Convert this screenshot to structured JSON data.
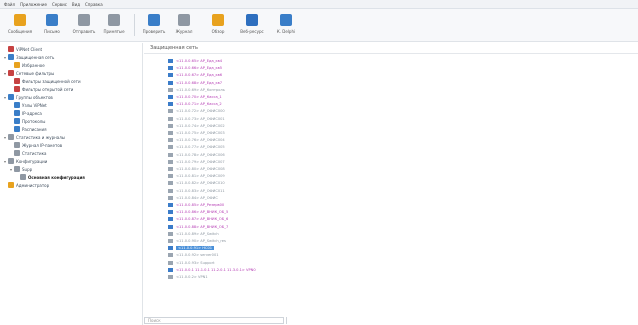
{
  "menu": {
    "items": [
      "Файл",
      "Приложение",
      "Сервис",
      "Вид",
      "Справка"
    ]
  },
  "toolbar": {
    "left_buttons": [
      {
        "label": "Сообщения",
        "icon": "messages-icon",
        "color": "#e8a21e"
      },
      {
        "label": "Письмо",
        "icon": "mail-icon",
        "color": "#3a7ec8"
      },
      {
        "label": "Отправить",
        "icon": "send-file-icon",
        "color": "#8f98a3"
      },
      {
        "label": "Принятые",
        "icon": "received-files-icon",
        "color": "#8f98a3"
      }
    ],
    "right_buttons": [
      {
        "label": "Проверить",
        "icon": "check-icon",
        "color": "#3a7ec8"
      },
      {
        "label": "Журнал",
        "icon": "journal-icon",
        "color": "#8f98a3"
      },
      {
        "label": "Обзор",
        "icon": "overview-icon",
        "color": "#e8a21e"
      },
      {
        "label": "Веб-ресурс",
        "icon": "web-resource-icon",
        "color": "#2e6fbf"
      },
      {
        "label": "К. Delphi",
        "icon": "connect-icon",
        "color": "#3a7ec8"
      }
    ]
  },
  "tree": {
    "items": [
      {
        "label": "ViPNet Client",
        "level": 0,
        "expander": "",
        "icon": "vipnet-client-icon",
        "color": "#c64242",
        "bold": false
      },
      {
        "label": "Защищенная сеть",
        "level": 0,
        "expander": "▾",
        "icon": "protected-network-icon",
        "color": "#3a7ec8",
        "bold": false
      },
      {
        "label": "Избранное",
        "level": 1,
        "expander": "",
        "icon": "favorites-icon",
        "color": "#e8a21e",
        "bold": false
      },
      {
        "label": "Сетевые фильтры",
        "level": 0,
        "expander": "▾",
        "icon": "network-filters-icon",
        "color": "#c64242",
        "bold": false
      },
      {
        "label": "Фильтры защищенной сети",
        "level": 1,
        "expander": "",
        "icon": "filter-icon",
        "color": "#c64242",
        "bold": false
      },
      {
        "label": "Фильтры открытой сети",
        "level": 1,
        "expander": "",
        "icon": "filter-icon",
        "color": "#c64242",
        "bold": false
      },
      {
        "label": "Группы объектов",
        "level": 0,
        "expander": "▾",
        "icon": "object-groups-icon",
        "color": "#3a7ec8",
        "bold": false
      },
      {
        "label": "Узлы ViPNet",
        "level": 1,
        "expander": "",
        "icon": "nodes-icon",
        "color": "#3a7ec8",
        "bold": false
      },
      {
        "label": "IP-адреса",
        "level": 1,
        "expander": "",
        "icon": "ip-address-icon",
        "color": "#3a7ec8",
        "bold": false
      },
      {
        "label": "Протоколы",
        "level": 1,
        "expander": "",
        "icon": "protocols-icon",
        "color": "#3a7ec8",
        "bold": false
      },
      {
        "label": "Расписания",
        "level": 1,
        "expander": "",
        "icon": "schedule-icon",
        "color": "#3a7ec8",
        "bold": false
      },
      {
        "label": "Статистика и журналы",
        "level": 0,
        "expander": "▾",
        "icon": "statistics-icon",
        "color": "#8f98a3",
        "bold": false
      },
      {
        "label": "Журнал IP-пакетов",
        "level": 1,
        "expander": "",
        "icon": "packet-log-icon",
        "color": "#8f98a3",
        "bold": false
      },
      {
        "label": "Статистика",
        "level": 1,
        "expander": "",
        "icon": "stats-icon",
        "color": "#8f98a3",
        "bold": false
      },
      {
        "label": "Конфигурации",
        "level": 0,
        "expander": "▾",
        "icon": "configurations-icon",
        "color": "#8f98a3",
        "bold": false
      },
      {
        "label": "Supp",
        "level": 1,
        "expander": "▾",
        "icon": "config-item-icon",
        "color": "#8f98a3",
        "bold": false
      },
      {
        "label": "Основная конфигурация",
        "level": 2,
        "expander": "",
        "icon": "main-config-icon",
        "color": "#8f98a3",
        "bold": true
      },
      {
        "label": "Администратор",
        "level": 0,
        "expander": "",
        "icon": "administrator-icon",
        "color": "#e8a21e",
        "bold": false
      }
    ]
  },
  "main": {
    "title": "Защищенная сеть",
    "filter_placeholder": "Поиск",
    "rows": [
      {
        "text": "<11.0.0.65> AP_Еда_кв4",
        "kind": "vip"
      },
      {
        "text": "<11.0.0.66> AP_Еда_кв5",
        "kind": "vip"
      },
      {
        "text": "<11.0.0.67> AP_Еда_кв6",
        "kind": "vip"
      },
      {
        "text": "<11.0.0.68> AP_Еда_кв7",
        "kind": "vip"
      },
      {
        "text": "<11.0.0.69> AP_Контроль",
        "kind": "gray"
      },
      {
        "text": "<11.0.0.70> AP_Касса_1",
        "kind": "vip"
      },
      {
        "text": "<11.0.0.71> AP_Касса_2",
        "kind": "vip"
      },
      {
        "text": "<11.0.0.72> AP_ОФИС000",
        "kind": "gray"
      },
      {
        "text": "<11.0.0.73> AP_ОФИС001",
        "kind": "gray"
      },
      {
        "text": "<11.0.0.74> AP_ОФИС002",
        "kind": "gray"
      },
      {
        "text": "<11.0.0.75> AP_ОФИС003",
        "kind": "gray"
      },
      {
        "text": "<11.0.0.76> AP_ОФИС004",
        "kind": "gray"
      },
      {
        "text": "<11.0.0.77> AP_ОФИС005",
        "kind": "gray"
      },
      {
        "text": "<11.0.0.78> AP_ОФИС006",
        "kind": "gray"
      },
      {
        "text": "<11.0.0.79> AP_ОФИС007",
        "kind": "gray"
      },
      {
        "text": "<11.0.0.80> AP_ОФИС008",
        "kind": "gray"
      },
      {
        "text": "<11.0.0.81> AP_ОФИС009",
        "kind": "gray"
      },
      {
        "text": "<11.0.0.82> AP_ОФИС010",
        "kind": "gray"
      },
      {
        "text": "<11.0.0.83> AP_ОФИС011",
        "kind": "gray"
      },
      {
        "text": "<11.0.0.84> AP_ОФИС",
        "kind": "gray"
      },
      {
        "text": "<11.0.0.85> AP_Резерв00",
        "kind": "vip"
      },
      {
        "text": "<11.0.0.86> AP_ВНИК_ОБ_5",
        "kind": "vip"
      },
      {
        "text": "<11.0.0.87> AP_ВНИК_ОБ_6",
        "kind": "vip"
      },
      {
        "text": "<11.0.0.88> AP_ВНИК_ОБ_7",
        "kind": "vip"
      },
      {
        "text": "<11.0.0.89> AP_Switch",
        "kind": "gray"
      },
      {
        "text": "<11.0.0.90> AP_Switch_res",
        "kind": "gray"
      },
      {
        "text": "<11.0.0.91> HC01",
        "kind": "selected"
      },
      {
        "text": "<11.0.0.92> server001",
        "kind": "gray"
      },
      {
        "text": "<11.0.0.93> Support",
        "kind": "gray"
      },
      {
        "text": "<11.0.0.1 11.1.0.1 11.2.0.1 11.3.0.1> VPN0",
        "kind": "vip"
      },
      {
        "text": "<11.0.0.2> VPN1",
        "kind": "gray"
      }
    ]
  },
  "colors": {
    "vip": "#b43ab3",
    "gray": "#8c96a0",
    "selected_bg": "#4a90d9",
    "icon_vip": "#3b7cc9",
    "icon_gray": "#9aa5b1"
  }
}
